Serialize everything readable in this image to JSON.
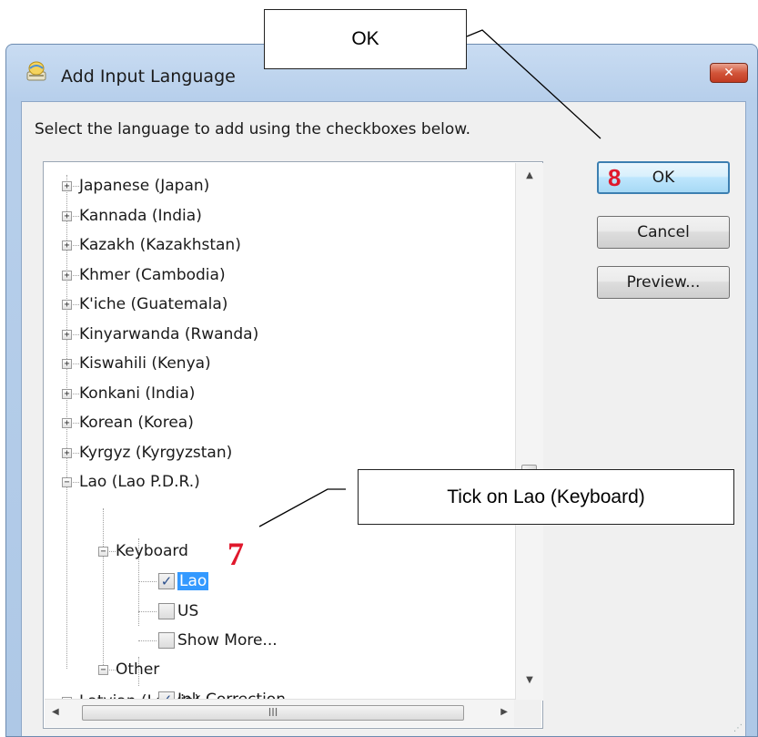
{
  "window": {
    "title": "Add Input Language",
    "close_label": "✕"
  },
  "instruction": "Select the language to add using the checkboxes below.",
  "buttons": {
    "ok": "OK",
    "cancel": "Cancel",
    "preview": "Preview..."
  },
  "tree": {
    "languages": [
      {
        "label": "Japanese (Japan)",
        "expanded": false
      },
      {
        "label": "Kannada (India)",
        "expanded": false
      },
      {
        "label": "Kazakh (Kazakhstan)",
        "expanded": false
      },
      {
        "label": "Khmer (Cambodia)",
        "expanded": false
      },
      {
        "label": "K'iche (Guatemala)",
        "expanded": false
      },
      {
        "label": "Kinyarwanda (Rwanda)",
        "expanded": false
      },
      {
        "label": "Kiswahili (Kenya)",
        "expanded": false
      },
      {
        "label": "Konkani (India)",
        "expanded": false
      },
      {
        "label": "Korean (Korea)",
        "expanded": false
      },
      {
        "label": "Kyrgyz (Kyrgyzstan)",
        "expanded": false
      },
      {
        "label": "Lao (Lao P.D.R.)",
        "expanded": true
      },
      {
        "label": "Latvian (Latvia)",
        "expanded": false
      }
    ],
    "lao_children": {
      "keyboard_group": "Keyboard",
      "keyboard_items": [
        {
          "label": "Lao",
          "checked": true,
          "selected": true
        },
        {
          "label": "US",
          "checked": false
        },
        {
          "label": "Show More...",
          "checked": false
        }
      ],
      "other_group": "Other",
      "other_items": [
        {
          "label": "Ink Correction",
          "checked": true
        }
      ]
    },
    "expand_glyph": "+",
    "collapse_glyph": "−",
    "check_glyph": "✓"
  },
  "scrollbar": {
    "up": "▲",
    "down": "▼",
    "left": "◀",
    "right": "▶",
    "thumb_grip": "III"
  },
  "annotations": {
    "ok_callout": "OK",
    "lao_callout": "Tick on Lao (Keyboard)",
    "step7": "7",
    "step8": "8"
  },
  "colors": {
    "step_marker": "#e0182c",
    "selection": "#3399ff"
  }
}
